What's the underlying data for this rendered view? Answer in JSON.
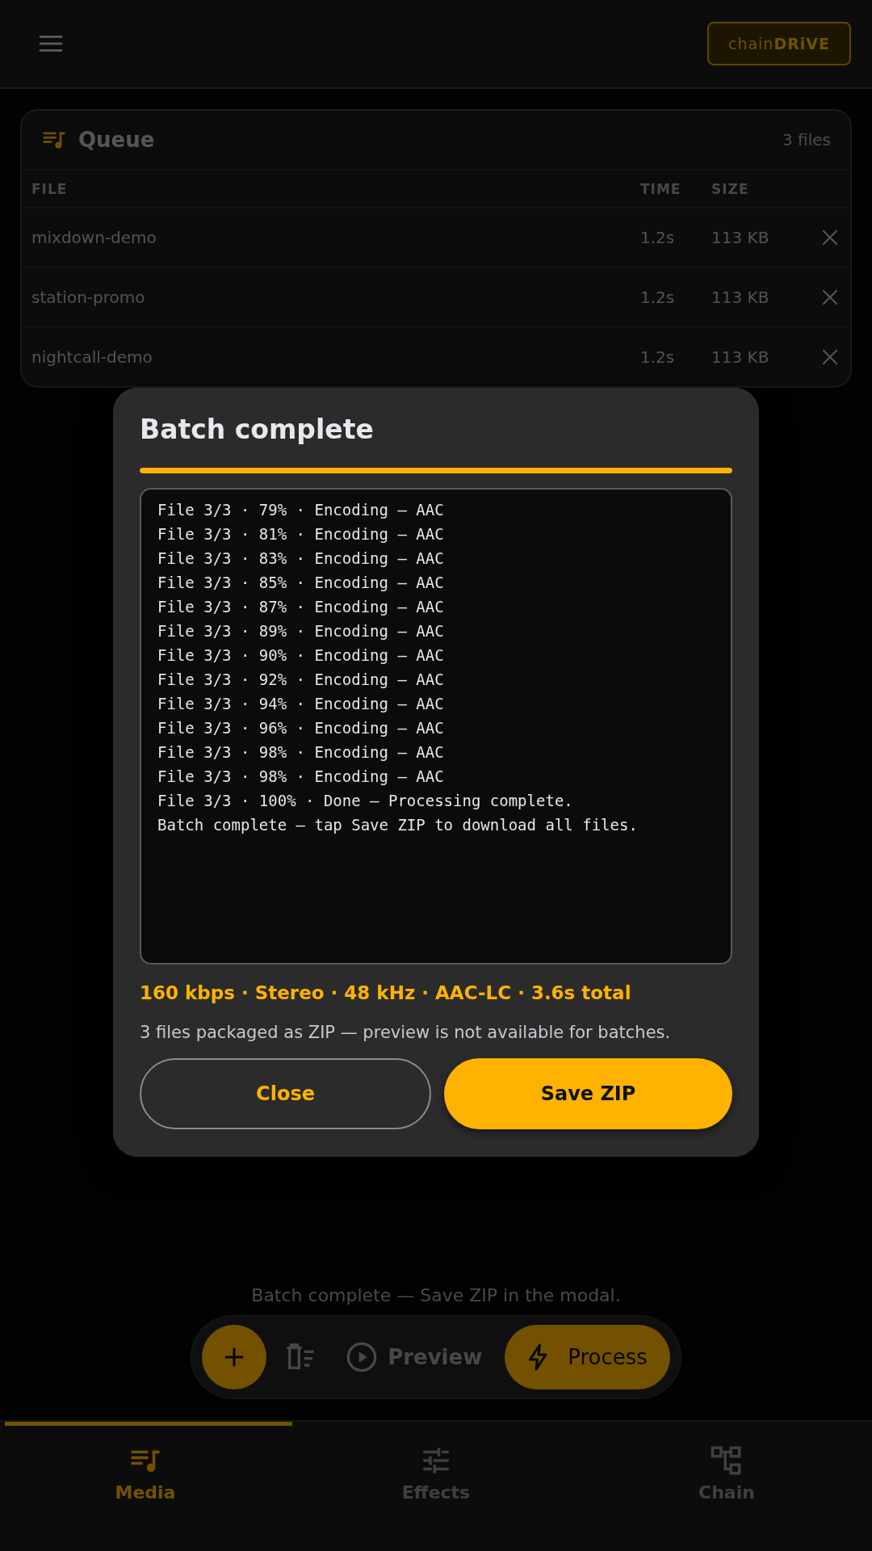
{
  "header": {
    "logo_plain": "chain",
    "logo_bold": "DRiVE"
  },
  "queue": {
    "title": "Queue",
    "count": "3 files",
    "columns": [
      "FILE",
      "TIME",
      "SIZE"
    ],
    "rows": [
      {
        "file": "mixdown-demo",
        "time": "1.2s",
        "size": "113 KB"
      },
      {
        "file": "station-promo",
        "time": "1.2s",
        "size": "113 KB"
      },
      {
        "file": "nightcall-demo",
        "time": "1.2s",
        "size": "113 KB"
      }
    ]
  },
  "modal": {
    "title": "Batch complete",
    "level": 1,
    "log": [
      "File 3/3 · 79% · Encoding — AAC",
      "File 3/3 · 81% · Encoding — AAC",
      "File 3/3 · 83% · Encoding — AAC",
      "File 3/3 · 85% · Encoding — AAC",
      "File 3/3 · 87% · Encoding — AAC",
      "File 3/3 · 89% · Encoding — AAC",
      "File 3/3 · 90% · Encoding — AAC",
      "File 3/3 · 92% · Encoding — AAC",
      "File 3/3 · 94% · Encoding — AAC",
      "File 3/3 · 96% · Encoding — AAC",
      "File 3/3 · 98% · Encoding — AAC",
      "File 3/3 · 98% · Encoding — AAC",
      "File 3/3 · 100% · Done — Processing complete.",
      "Batch complete — tap Save ZIP to download all files."
    ],
    "stats": "160 kbps · Stereo · 48 kHz · AAC-LC · 3.6s total",
    "info": "3 files packaged as ZIP — preview is not available for batches.",
    "buttons": [
      {
        "label": "Close",
        "kind": "secondary"
      },
      {
        "label": "Save ZIP",
        "kind": "primary"
      }
    ]
  },
  "status": "Batch complete — Save ZIP in the modal.",
  "dock": {
    "preview": "Preview",
    "process": "Process"
  },
  "nav": {
    "level": 0.333,
    "tabs": [
      {
        "label": "Media",
        "selected": true
      },
      {
        "label": "Effects",
        "selected": false
      },
      {
        "label": "Chain",
        "selected": false
      }
    ]
  }
}
